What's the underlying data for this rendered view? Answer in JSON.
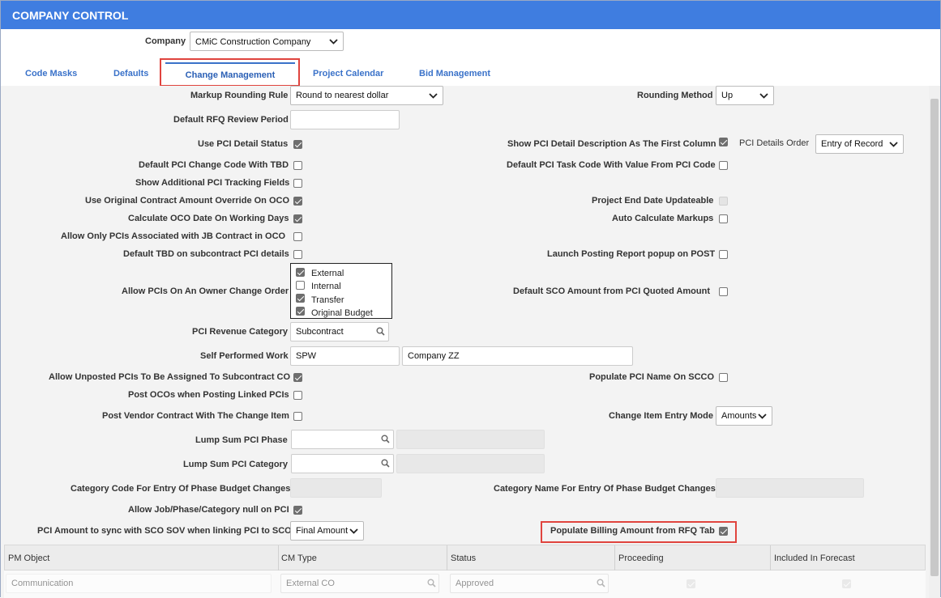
{
  "window": {
    "title": "COMPANY CONTROL"
  },
  "company": {
    "label": "Company",
    "value": "CMiC Construction Company"
  },
  "tabs": [
    {
      "label": "Code Masks"
    },
    {
      "label": "Defaults"
    },
    {
      "label": "Change Management"
    },
    {
      "label": "Project Calendar"
    },
    {
      "label": "Bid Management"
    }
  ],
  "form": {
    "markup_rounding_rule": {
      "label": "Markup Rounding Rule",
      "value": "Round to nearest dollar"
    },
    "rounding_method": {
      "label": "Rounding Method",
      "value": "Up"
    },
    "default_rfq_review_period": {
      "label": "Default RFQ Review Period",
      "value": ""
    },
    "use_pci_detail_status": {
      "label": "Use PCI Detail Status",
      "checked": true
    },
    "show_pci_detail_desc_first": {
      "label": "Show PCI Detail Description As The First Column",
      "checked": true
    },
    "pci_details_order": {
      "label": "PCI Details Order",
      "value": "Entry of Record"
    },
    "default_pci_change_code_tbd": {
      "label": "Default PCI Change Code With TBD",
      "checked": false
    },
    "default_pci_task_code": {
      "label": "Default PCI Task Code With Value From PCI Code",
      "checked": false
    },
    "show_additional_pci_tracking": {
      "label": "Show Additional PCI Tracking Fields",
      "checked": false
    },
    "use_original_contract_override": {
      "label": "Use Original Contract Amount Override On OCO",
      "checked": true
    },
    "project_end_date_updateable": {
      "label": "Project End Date Updateable",
      "checked": false
    },
    "calc_oco_date_working_days": {
      "label": "Calculate OCO Date On Working Days",
      "checked": true
    },
    "auto_calc_markups": {
      "label": "Auto Calculate Markups",
      "checked": false
    },
    "allow_only_pcis_jb": {
      "label": "Allow Only PCIs Associated with JB Contract in OCO",
      "checked": false
    },
    "default_tbd_subcontract": {
      "label": "Default TBD on subcontract PCI details",
      "checked": false
    },
    "launch_posting_report": {
      "label": "Launch Posting Report popup on POST",
      "checked": false
    },
    "allow_pcis_owner_co": {
      "label": "Allow PCIs On An Owner Change Order",
      "options": [
        {
          "label": "External",
          "checked": true
        },
        {
          "label": "Internal",
          "checked": false
        },
        {
          "label": "Transfer",
          "checked": true
        },
        {
          "label": "Original Budget",
          "checked": true
        }
      ]
    },
    "default_sco_amount": {
      "label": "Default SCO Amount from PCI Quoted Amount",
      "checked": false
    },
    "pci_revenue_category": {
      "label": "PCI Revenue Category",
      "value": "Subcontract"
    },
    "self_performed_work": {
      "label": "Self Performed Work",
      "code": "SPW",
      "name": "Company ZZ"
    },
    "allow_unposted_pcis": {
      "label": "Allow Unposted PCIs To Be Assigned To Subcontract CO",
      "checked": true
    },
    "populate_pci_name_scco": {
      "label": "Populate PCI Name On SCCO",
      "checked": false
    },
    "post_ocos_linked": {
      "label": "Post OCOs when Posting Linked PCIs",
      "checked": false
    },
    "post_vendor_contract": {
      "label": "Post Vendor Contract With The Change Item",
      "checked": false
    },
    "change_item_entry_mode": {
      "label": "Change Item Entry Mode",
      "value": "Amounts"
    },
    "lump_sum_pci_phase": {
      "label": "Lump Sum PCI Phase",
      "value": ""
    },
    "lump_sum_pci_category": {
      "label": "Lump Sum PCI Category",
      "value": ""
    },
    "category_code_phase_budget": {
      "label": "Category Code For Entry Of Phase Budget Changes",
      "value": ""
    },
    "category_name_phase_budget": {
      "label": "Category Name For Entry Of Phase Budget Changes",
      "value": ""
    },
    "allow_job_phase_category_null": {
      "label": "Allow Job/Phase/Category null on PCI",
      "checked": true
    },
    "pci_amount_sync": {
      "label": "PCI Amount to sync with SCO SOV when linking PCI to SCO",
      "value": "Final Amount"
    },
    "populate_billing_amount_rfq": {
      "label": "Populate Billing Amount from RFQ Tab",
      "checked": true
    }
  },
  "grid": {
    "columns": [
      "PM Object",
      "CM Type",
      "Status",
      "Proceeding",
      "Included In Forecast"
    ],
    "rows": [
      {
        "pm_object": "Communication",
        "cm_type": "External CO",
        "status": "Approved",
        "proceeding": true,
        "included": true
      }
    ]
  },
  "colors": {
    "titlebar": "#3f7de0",
    "tab_text": "#3a72c9",
    "highlight": "#e0443e"
  }
}
